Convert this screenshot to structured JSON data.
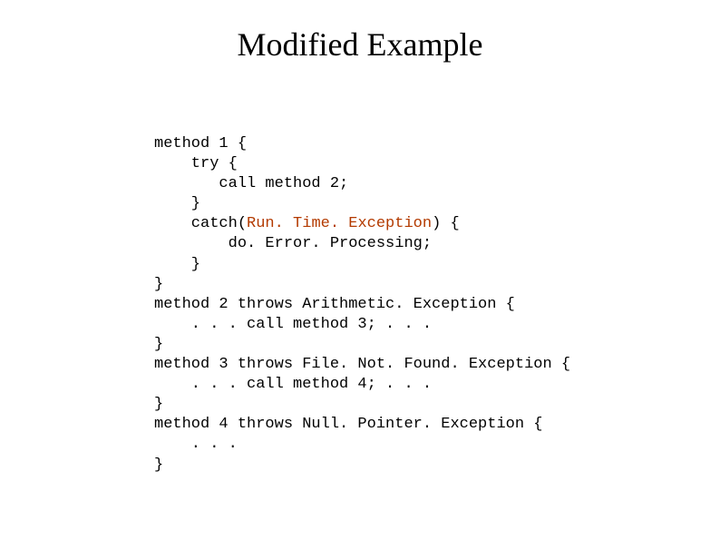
{
  "title": "Modified Example",
  "code": {
    "l1": "method 1 {",
    "l2": "    try {",
    "l3": "       call method 2;",
    "l4": "    }",
    "l5a": "    catch(",
    "l5b": "Run. Time. Exception",
    "l5c": ") {",
    "l6": "        do. Error. Processing;",
    "l7": "    }",
    "l8": "}",
    "l9": "method 2 throws Arithmetic. Exception {",
    "l10": "    . . . call method 3; . . .",
    "l11": "}",
    "l12": "method 3 throws File. Not. Found. Exception {",
    "l13": "    . . . call method 4; . . .",
    "l14": "}",
    "l15": "method 4 throws Null. Pointer. Exception {",
    "l16": "    . . .",
    "l17": "}"
  },
  "colors": {
    "highlight": "#b33a00",
    "text": "#000000",
    "background": "#ffffff"
  }
}
